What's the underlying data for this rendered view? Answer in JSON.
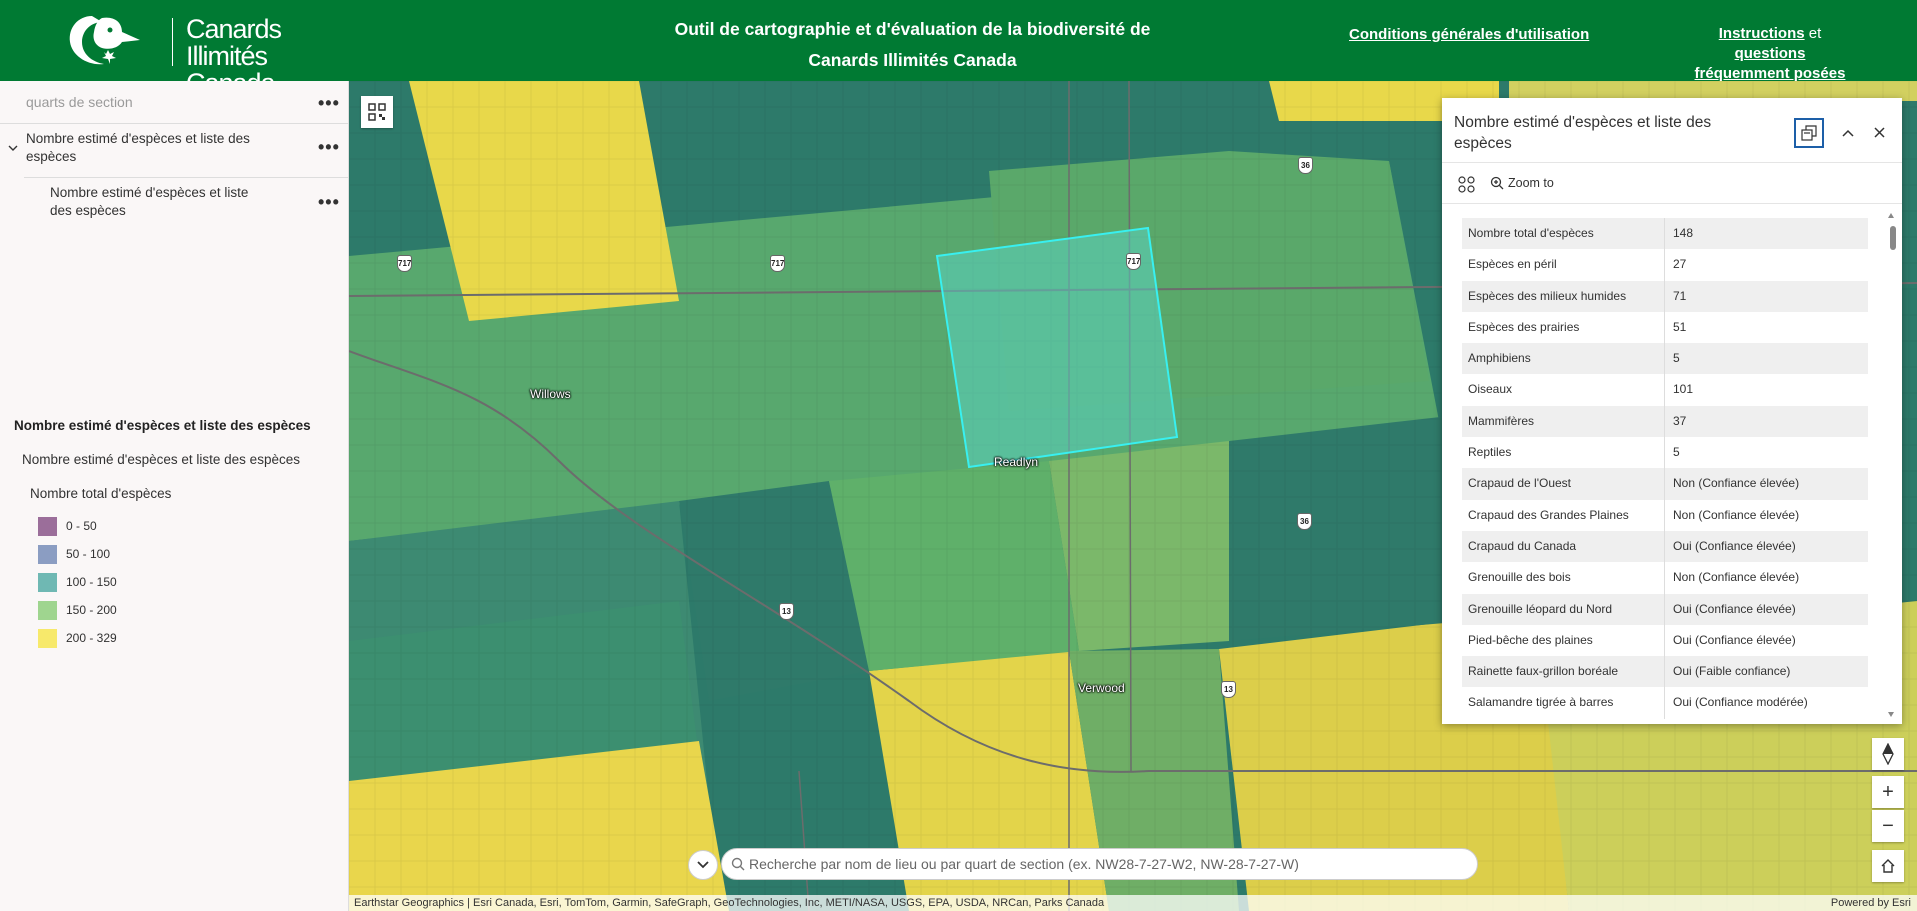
{
  "header": {
    "brand_line1": "Canards Illimités",
    "brand_line2": "Canada",
    "title_line1": "Outil de cartographie et d'évaluation de la biodiversité de",
    "title_line2": "Canards Illimités Canada",
    "terms_link": "Conditions générales d'utilisation",
    "instructions_link": "Instructions",
    "instructions_and": " et ",
    "faq_link_1": "questions",
    "faq_link_2": "fréquemment posées",
    "bg_color": "#007a33"
  },
  "sidebar": {
    "layers": [
      {
        "label": "quarts de section"
      },
      {
        "label": "Nombre estimé d'espèces et liste des espèces"
      },
      {
        "label": "Nombre estimé d'espèces et liste des espèces"
      }
    ],
    "legend": {
      "title": "Nombre estimé d'espèces et liste des espèces",
      "subtitle": "Nombre estimé d'espèces et liste des espèces",
      "field": "Nombre total d'espèces",
      "classes": [
        {
          "label": "0 - 50",
          "color": "#9b6e9a"
        },
        {
          "label": "50 - 100",
          "color": "#8b9dc2"
        },
        {
          "label": "100 - 150",
          "color": "#6fb8b3"
        },
        {
          "label": "150 - 200",
          "color": "#9fd58f"
        },
        {
          "label": "200 - 329",
          "color": "#f7e96b"
        }
      ]
    }
  },
  "map": {
    "towns": [
      "Willows",
      "Readlyn",
      "Verwood"
    ],
    "highways": [
      "717",
      "717",
      "717",
      "36",
      "36",
      "13",
      "13"
    ],
    "search_placeholder": "Recherche par nom de lieu ou par quart de section (ex. NW28-7-27-W2, NW-28-7-27-W)",
    "attribution": "Earthstar Geographics | Esri Canada, Esri, TomTom, Garmin, SafeGraph, GeoTechnologies, Inc, METI/NASA, USGS, EPA, USDA, NRCan, Parks Canada",
    "powered_by": "Powered by Esri",
    "zoom_in": "+",
    "zoom_out": "−"
  },
  "popup": {
    "title": "Nombre estimé d'espèces et liste des espèces",
    "zoom_to": "Zoom to",
    "rows": [
      {
        "k": "Nombre total d'espèces",
        "v": "148"
      },
      {
        "k": "Espèces en péril",
        "v": "27"
      },
      {
        "k": "Espèces des milieux humides",
        "v": "71"
      },
      {
        "k": "Espèces des prairies",
        "v": "51"
      },
      {
        "k": "Amphibiens",
        "v": "5"
      },
      {
        "k": "Oiseaux",
        "v": "101"
      },
      {
        "k": "Mammifères",
        "v": "37"
      },
      {
        "k": "Reptiles",
        "v": "5"
      },
      {
        "k": "Crapaud de l'Ouest",
        "v": "Non (Confiance élevée)"
      },
      {
        "k": "Crapaud des Grandes Plaines",
        "v": "Non (Confiance élevée)"
      },
      {
        "k": "Crapaud du Canada",
        "v": "Oui (Confiance élevée)"
      },
      {
        "k": "Grenouille des bois",
        "v": "Non (Confiance élevée)"
      },
      {
        "k": "Grenouille léopard du Nord",
        "v": "Oui (Confiance élevée)"
      },
      {
        "k": "Pied-bêche des plaines",
        "v": "Oui (Confiance élevée)"
      },
      {
        "k": "Rainette faux-grillon boréale",
        "v": "Oui (Faible confiance)"
      },
      {
        "k": "Salamandre tigrée à barres",
        "v": "Oui (Confiance modérée)"
      }
    ]
  }
}
